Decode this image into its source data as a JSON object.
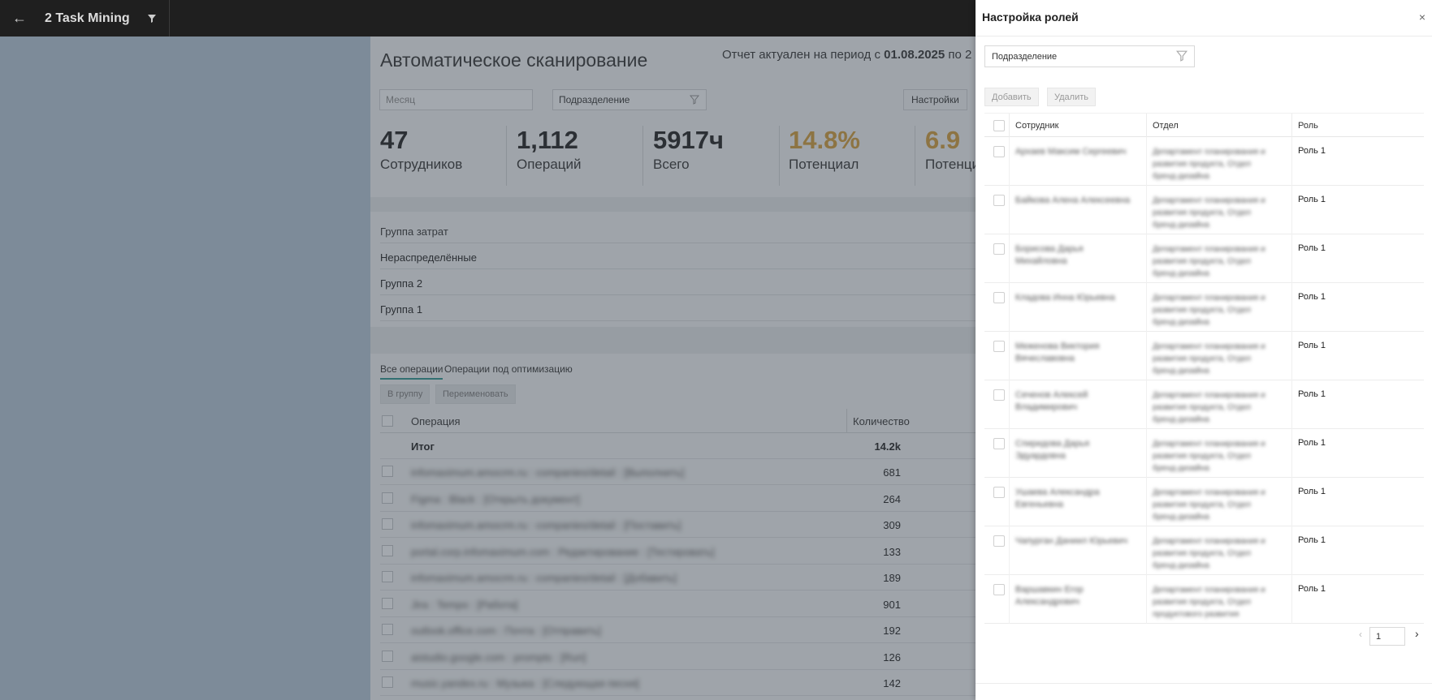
{
  "app": {
    "title": "2 Task Mining",
    "back_icon": "arrow-left-icon",
    "filter_icon": "funnel-icon"
  },
  "page": {
    "title": "Автоматическое сканирование",
    "report_prefix": "Отчет актуален на период с ",
    "report_date": "01.08.2025",
    "report_to": " по 2",
    "month_placeholder": "Месяц",
    "division_select": "Подразделение",
    "settings_button": "Настройки"
  },
  "kpis": [
    {
      "value": "47",
      "label": "Сотрудников"
    },
    {
      "value": "1,112",
      "label": "Операций"
    },
    {
      "value": "5917ч",
      "label": "Всего"
    },
    {
      "value": "14.8%",
      "label": "Потенциал"
    },
    {
      "value": "6.9",
      "label": "Потенци"
    }
  ],
  "groups": {
    "header": "Группа затрат",
    "rows": [
      "Нераспределённые",
      "Группа 2",
      "Группа 1"
    ]
  },
  "operations": {
    "tabs": [
      "Все операции",
      "Операции под оптимизацию"
    ],
    "to_group": "В группу",
    "rename": "Переименовать",
    "col_operation": "Операция",
    "col_count": "Количество",
    "total_label": "Итог",
    "total_value": "14.2k",
    "rows": [
      {
        "name": "infomaximum.amocrm.ru : companies/detail : [Выполнить]",
        "count": "681"
      },
      {
        "name": "Figma : Black : [Открыть документ]",
        "count": "264"
      },
      {
        "name": "infomaximum.amocrm.ru : companies/detail : [Поставить]",
        "count": "309"
      },
      {
        "name": "portal.corp.infomaximum.com : Редактирование : [Тестировать]",
        "count": "133"
      },
      {
        "name": "infomaximum.amocrm.ru : companies/detail : [Добавить]",
        "count": "189"
      },
      {
        "name": "Jira : Tempo : [Работа]",
        "count": "901"
      },
      {
        "name": "outlook.office.com : Почта : [Отправить]",
        "count": "192"
      },
      {
        "name": "aistudio.google.com : prompts : [Run]",
        "count": "126"
      },
      {
        "name": "music.yandex.ru : Музыка : [Следующая песня]",
        "count": "142"
      }
    ]
  },
  "drawer": {
    "title": "Настройка ролей",
    "close_icon": "close-icon",
    "division_select": "Подразделение",
    "add_button": "Добавить",
    "delete_button": "Удалить",
    "col_employee": "Сотрудник",
    "col_department": "Отдел",
    "col_role": "Роль",
    "rows": [
      {
        "employee": "Архаев Максим Сергеевич",
        "department": "Департамент планирования и развития продукта, Отдел бренд-дизайна",
        "role": "Роль 1"
      },
      {
        "employee": "Байкова Алена Алексеевна",
        "department": "Департамент планирования и развития продукта, Отдел бренд-дизайна",
        "role": "Роль 1"
      },
      {
        "employee": "Борисова Дарья Михайловна",
        "department": "Департамент планирования и развития продукта, Отдел бренд-дизайна",
        "role": "Роль 1"
      },
      {
        "employee": "Кладова Инна Юрьевна",
        "department": "Департамент планирования и развития продукта, Отдел бренд-дизайна",
        "role": "Роль 1"
      },
      {
        "employee": "Меженова Виктория Вячеславовна",
        "department": "Департамент планирования и развития продукта, Отдел бренд-дизайна",
        "role": "Роль 1"
      },
      {
        "employee": "Сеченов Алексей Владимирович",
        "department": "Департамент планирования и развития продукта, Отдел бренд-дизайна",
        "role": "Роль 1"
      },
      {
        "employee": "Спиридова Дарья Эдуардовна",
        "department": "Департамент планирования и развития продукта, Отдел бренд-дизайна",
        "role": "Роль 1"
      },
      {
        "employee": "Ушаева Александра Евгеньевна",
        "department": "Департамент планирования и развития продукта, Отдел бренд-дизайна",
        "role": "Роль 1"
      },
      {
        "employee": "Чапурган Даниил Юрьевич",
        "department": "Департамент планирования и развития продукта, Отдел бренд-дизайна",
        "role": "Роль 1"
      },
      {
        "employee": "Варшавкин Егор Александрович",
        "department": "Департамент планирования и развития продукта, Отдел продуктового развития",
        "role": "Роль 1"
      }
    ],
    "page": "1",
    "prev_icon": "chevron-left-icon",
    "next_icon": "chevron-right-icon"
  }
}
